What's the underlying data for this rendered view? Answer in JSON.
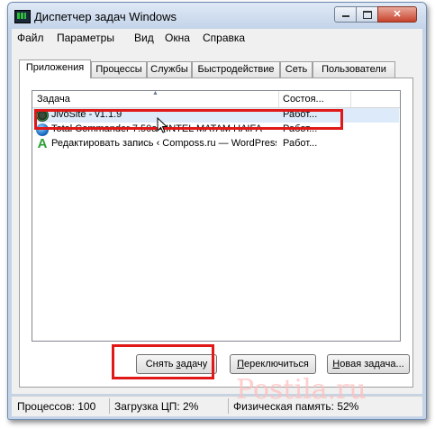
{
  "window": {
    "title": "Диспетчер задач Windows"
  },
  "menu": [
    "Файл",
    "Параметры",
    "Вид",
    "Окна",
    "Справка"
  ],
  "tabs": [
    {
      "label": "Приложения",
      "active": true
    },
    {
      "label": "Процессы",
      "active": false
    },
    {
      "label": "Службы",
      "active": false
    },
    {
      "label": "Быстродействие",
      "active": false
    },
    {
      "label": "Сеть",
      "active": false
    },
    {
      "label": "Пользователи",
      "active": false
    }
  ],
  "list": {
    "columns": {
      "task": "Задача",
      "status": "Состоя..."
    },
    "rows": [
      {
        "name": "JivoSite - v1.1.9",
        "status": "Работ...",
        "icon": "jivosite-icon",
        "selected": true
      },
      {
        "name": "Total Commander 7.50a - INTEL MATAM HAIFA",
        "status": "Работ...",
        "icon": "total-commander-icon",
        "selected": false
      },
      {
        "name": "Редактировать запись ‹ Composs.ru — WordPress",
        "status": "Работ...",
        "icon": "green-a-icon",
        "selected": false
      }
    ]
  },
  "buttons": {
    "end_task": {
      "pre": "Снять ",
      "ul": "з",
      "post": "адачу"
    },
    "switch": {
      "pre": "",
      "ul": "П",
      "post": "ереключиться"
    },
    "new_task": {
      "pre": "",
      "ul": "Н",
      "post": "овая задача..."
    }
  },
  "statusbar": {
    "processes": "Процессов: 100",
    "cpu": "Загрузка ЦП: 2%",
    "memory": "Физическая память: 52%"
  },
  "watermark": "Postila.ru",
  "colors": {
    "highlight": "#e01818",
    "selection": "#ddeaf9"
  }
}
